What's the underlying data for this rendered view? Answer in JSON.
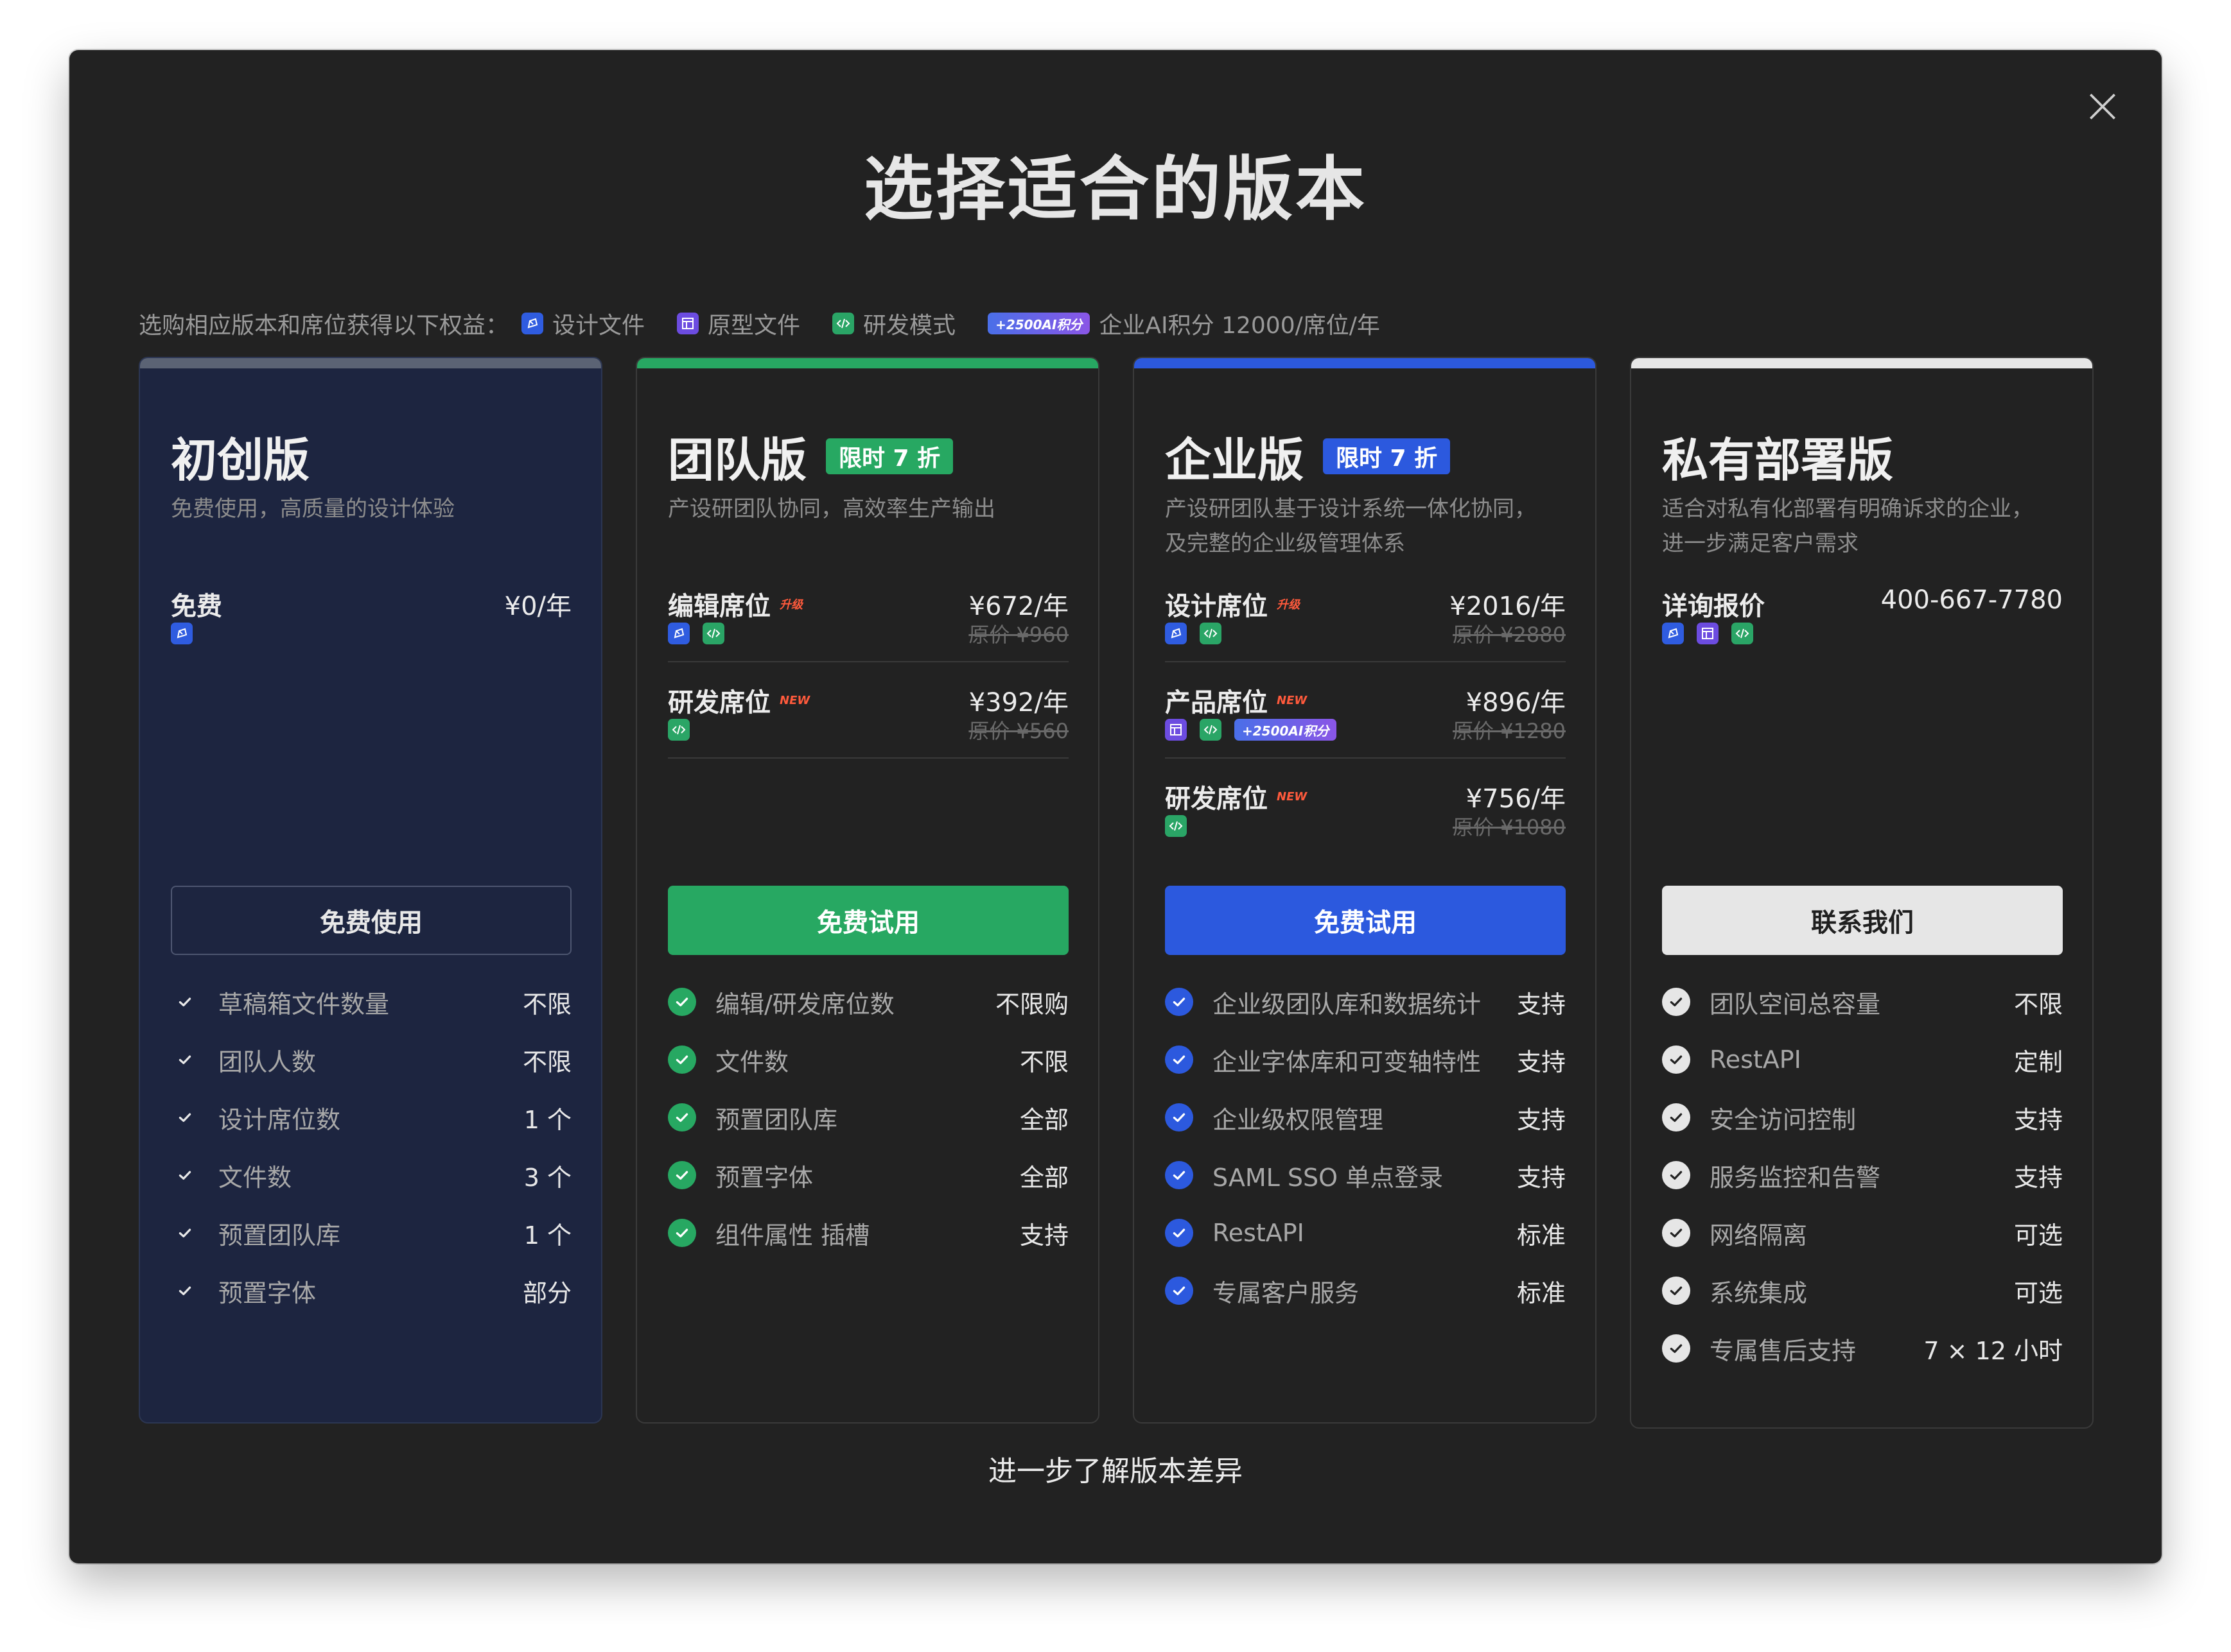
{
  "dialog": {
    "title": "选择适合的版本",
    "benefits_intro": "选购相应版本和席位获得以下权益：",
    "benefits": {
      "design": "设计文件",
      "proto": "原型文件",
      "dev": "研发模式",
      "ai_badge": "+2500AI积分",
      "ai_text": "企业AI积分 12000/席位/年"
    },
    "footer_link": "进一步了解版本差异"
  },
  "plans": {
    "starter": {
      "name": "初创版",
      "desc": "免费使用，高质量的设计体验",
      "seat": {
        "name": "免费",
        "price": "¥0/年"
      },
      "cta": "免费使用",
      "features": [
        {
          "label": "草稿箱文件数量",
          "value": "不限"
        },
        {
          "label": "团队人数",
          "value": "不限"
        },
        {
          "label": "设计席位数",
          "value": "1 个"
        },
        {
          "label": "文件数",
          "value": "3 个"
        },
        {
          "label": "预置团队库",
          "value": "1 个"
        },
        {
          "label": "预置字体",
          "value": "部分"
        }
      ]
    },
    "team": {
      "name": "团队版",
      "promo": "限时 7 折",
      "desc": "产设研团队协同，高效率生产输出",
      "seats": [
        {
          "name": "编辑席位",
          "tag": "升级",
          "price": "¥672/年",
          "orig": "原价 ¥960"
        },
        {
          "name": "研发席位",
          "tag": "NEW",
          "price": "¥392/年",
          "orig": "原价 ¥560"
        }
      ],
      "cta": "免费试用",
      "features": [
        {
          "label": "编辑/研发席位数",
          "value": "不限购"
        },
        {
          "label": "文件数",
          "value": "不限"
        },
        {
          "label": "预置团队库",
          "value": "全部"
        },
        {
          "label": "预置字体",
          "value": "全部"
        },
        {
          "label": "组件属性 插槽",
          "value": "支持"
        }
      ]
    },
    "enterprise": {
      "name": "企业版",
      "promo": "限时 7 折",
      "desc_line1": "产设研团队基于设计系统一体化协同，",
      "desc_line2": "及完整的企业级管理体系",
      "seats": [
        {
          "name": "设计席位",
          "tag": "升级",
          "price": "¥2016/年",
          "orig": "原价 ¥2880"
        },
        {
          "name": "产品席位",
          "tag": "NEW",
          "price": "¥896/年",
          "orig": "原价 ¥1280"
        },
        {
          "name": "研发席位",
          "tag": "NEW",
          "price": "¥756/年",
          "orig": "原价 ¥1080"
        }
      ],
      "cta": "免费试用",
      "features": [
        {
          "label": "企业级团队库和数据统计",
          "value": "支持"
        },
        {
          "label": "企业字体库和可变轴特性",
          "value": "支持"
        },
        {
          "label": "企业级权限管理",
          "value": "支持"
        },
        {
          "label": "SAML SSO 单点登录",
          "value": "支持"
        },
        {
          "label": "RestAPI",
          "value": "标准"
        },
        {
          "label": "专属客户服务",
          "value": "标准"
        }
      ]
    },
    "private": {
      "name": "私有部署版",
      "desc_line1": "适合对私有化部署有明确诉求的企业，",
      "desc_line2": "进一步满足客户需求",
      "seat": {
        "name": "详询报价",
        "price": "400-667-7780"
      },
      "cta": "联系我们",
      "features": [
        {
          "label": "团队空间总容量",
          "value": "不限"
        },
        {
          "label": "RestAPI",
          "value": "定制"
        },
        {
          "label": "安全访问控制",
          "value": "支持"
        },
        {
          "label": "服务监控和告警",
          "value": "支持"
        },
        {
          "label": "网络隔离",
          "value": "可选"
        },
        {
          "label": "系统集成",
          "value": "可选"
        },
        {
          "label": "专属售后支持",
          "value": "7 × 12 小时"
        }
      ]
    }
  },
  "colors": {
    "green": "#27a862",
    "blue": "#2c59de",
    "starter_bg": "#1d2540",
    "private_bar": "#e6e6e6"
  }
}
